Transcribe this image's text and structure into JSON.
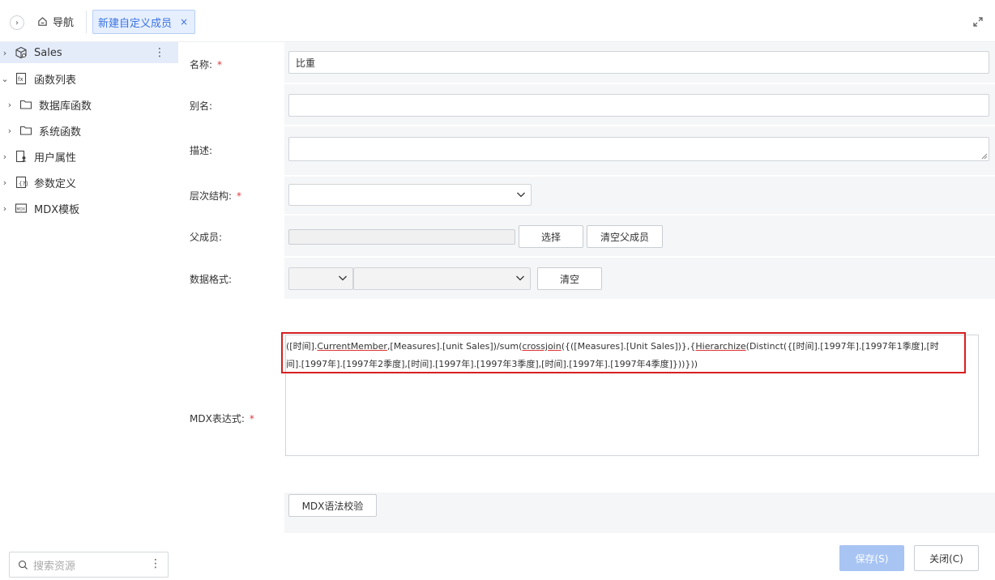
{
  "topbar": {
    "nav_label": "导航",
    "active_tab_label": "新建自定义成员",
    "tab_close": "×"
  },
  "sidebar": {
    "items": [
      {
        "label": "Sales",
        "arrow": "›",
        "icon": "cube-icon"
      },
      {
        "label": "函数列表",
        "arrow": "⌄",
        "icon": "function-list-icon"
      },
      {
        "label": "数据库函数",
        "arrow": "›",
        "icon": "folder-icon"
      },
      {
        "label": "系统函数",
        "arrow": "›",
        "icon": "folder-icon"
      },
      {
        "label": "用户属性",
        "arrow": "›",
        "icon": "user-property-icon"
      },
      {
        "label": "参数定义",
        "arrow": "›",
        "icon": "parameter-icon"
      },
      {
        "label": "MDX模板",
        "arrow": "›",
        "icon": "mdx-template-icon"
      }
    ],
    "search_placeholder": "搜索资源",
    "kebab": "⋮"
  },
  "form": {
    "name_label": "名称:",
    "name_value": "比重",
    "alias_label": "别名:",
    "alias_value": "",
    "desc_label": "描述:",
    "desc_value": "",
    "hierarchy_label": "层次结构:",
    "parent_label": "父成员:",
    "select_button": "选择",
    "clear_parent_button": "清空父成员",
    "format_label": "数据格式:",
    "clear_button": "清空",
    "mdx_label": "MDX表达式:",
    "required_mark": "*",
    "mdx_expr": {
      "part1": "([时间].",
      "u1": "CurrentMember",
      "part2": ",[Measures].[unit Sales])/sum(",
      "u2": "crossjoin",
      "part3": "({([Measures].[Unit Sales])},{",
      "u3": "Hierarchize",
      "part4": "(Distinct({[时间].[1997年].[1997年1季度],[时间].[1997年].[1997年2季度],[时间].[1997年].[1997年3季度],[时间].[1997年].[1997年4季度]}))}))"
    },
    "validate_button": "MDX语法校验"
  },
  "footer": {
    "save_button": "保存(S)",
    "close_button": "关闭(C)"
  },
  "colors": {
    "accent": "#3b73e0",
    "highlight_border": "#d62020",
    "required": "#e0393e",
    "save_disabled": "#a8c4f3"
  }
}
